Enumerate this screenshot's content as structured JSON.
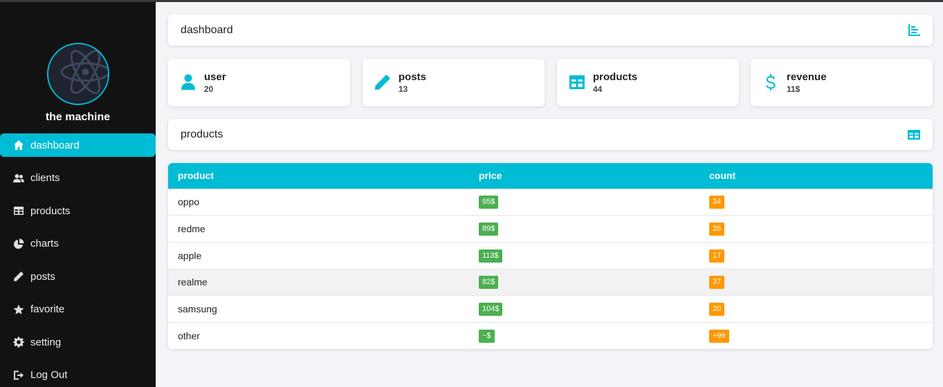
{
  "sidebar": {
    "username": "the machine",
    "items": [
      {
        "label": "dashboard",
        "icon": "home-icon",
        "active": true
      },
      {
        "label": "clients",
        "icon": "users-icon",
        "active": false
      },
      {
        "label": "products",
        "icon": "table-icon",
        "active": false
      },
      {
        "label": "charts",
        "icon": "pie-chart-icon",
        "active": false
      },
      {
        "label": "posts",
        "icon": "pencil-icon",
        "active": false
      },
      {
        "label": "favorite",
        "icon": "star-icon",
        "active": false
      },
      {
        "label": "setting",
        "icon": "gear-icon",
        "active": false
      },
      {
        "label": "Log Out",
        "icon": "logout-icon",
        "active": false
      }
    ]
  },
  "header": {
    "title": "dashboard",
    "icon": "bar-chart-icon"
  },
  "stats": [
    {
      "label": "user",
      "value": "20",
      "icon": "user-icon"
    },
    {
      "label": "posts",
      "value": "13",
      "icon": "pencil-icon"
    },
    {
      "label": "products",
      "value": "44",
      "icon": "table-icon"
    },
    {
      "label": "revenue",
      "value": "11$",
      "icon": "dollar-icon"
    }
  ],
  "products_section": {
    "title": "products",
    "icon": "table-icon"
  },
  "table": {
    "columns": [
      "product",
      "price",
      "count"
    ],
    "rows": [
      {
        "product": "oppo",
        "price": "95$",
        "count": "34"
      },
      {
        "product": "redme",
        "price": "89$",
        "count": "26"
      },
      {
        "product": "apple",
        "price": "113$",
        "count": "17"
      },
      {
        "product": "realme",
        "price": "82$",
        "count": "37"
      },
      {
        "product": "samsung",
        "price": "104$",
        "count": "20"
      },
      {
        "product": "other",
        "price": "~$",
        "count": "+99"
      }
    ]
  },
  "colors": {
    "accent": "#00bcd4",
    "sidebar_bg": "#121212",
    "price_badge": "#4caf50",
    "count_badge": "#ff9800"
  }
}
